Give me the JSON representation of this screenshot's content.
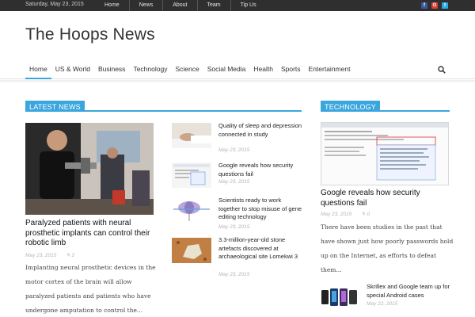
{
  "topbar": {
    "date": "Saturday, May 23, 2015",
    "links": [
      "Home",
      "News",
      "About",
      "Team",
      "Tip Us"
    ],
    "social_icons": [
      "facebook-icon",
      "google-plus-icon",
      "twitter-icon"
    ]
  },
  "site": {
    "title": "The Hoops News"
  },
  "nav": {
    "items": [
      "Home",
      "US & World",
      "Business",
      "Technology",
      "Science",
      "Social Media",
      "Health",
      "Sports",
      "Entertainment"
    ],
    "active": "Home"
  },
  "latest": {
    "heading": "LATEST NEWS",
    "featured": {
      "title": "Paralyzed patients with neural prosthetic implants can control their robotic limb",
      "date": "May 23, 2015",
      "comments": "2",
      "excerpt": "Implanting neural prosthetic devices in the motor cortex of the brain will allow paralyzed patients and patients who have undergone amputation to control the..."
    },
    "items": [
      {
        "title": "Quality of sleep and depression connected in study",
        "date": "May 23, 2015"
      },
      {
        "title": "Google reveals how security questions fail",
        "date": "May 23, 2015"
      },
      {
        "title": "Scientists ready to work together to stop misuse of gene editing technology",
        "date": "May 23, 2015"
      },
      {
        "title": "3.3-million-year-old stone artefacts discovered at archaeological site Lomekwi 3",
        "date": "May 23, 2015"
      }
    ]
  },
  "technology": {
    "heading": "TECHNOLOGY",
    "featured": {
      "title": "Google reveals how security questions fail",
      "date": "May 23, 2015",
      "comments": "0",
      "excerpt": "There have been studies in the past that have shown just how poorly passwords hold up on the Internet, as efforts to defeat them..."
    },
    "items": [
      {
        "title": "Skrillex and Google team up for special Android cases",
        "date": "May 22, 2015"
      }
    ]
  },
  "colors": {
    "accent": "#3aa6dd",
    "topbar": "#2f2f2f"
  }
}
